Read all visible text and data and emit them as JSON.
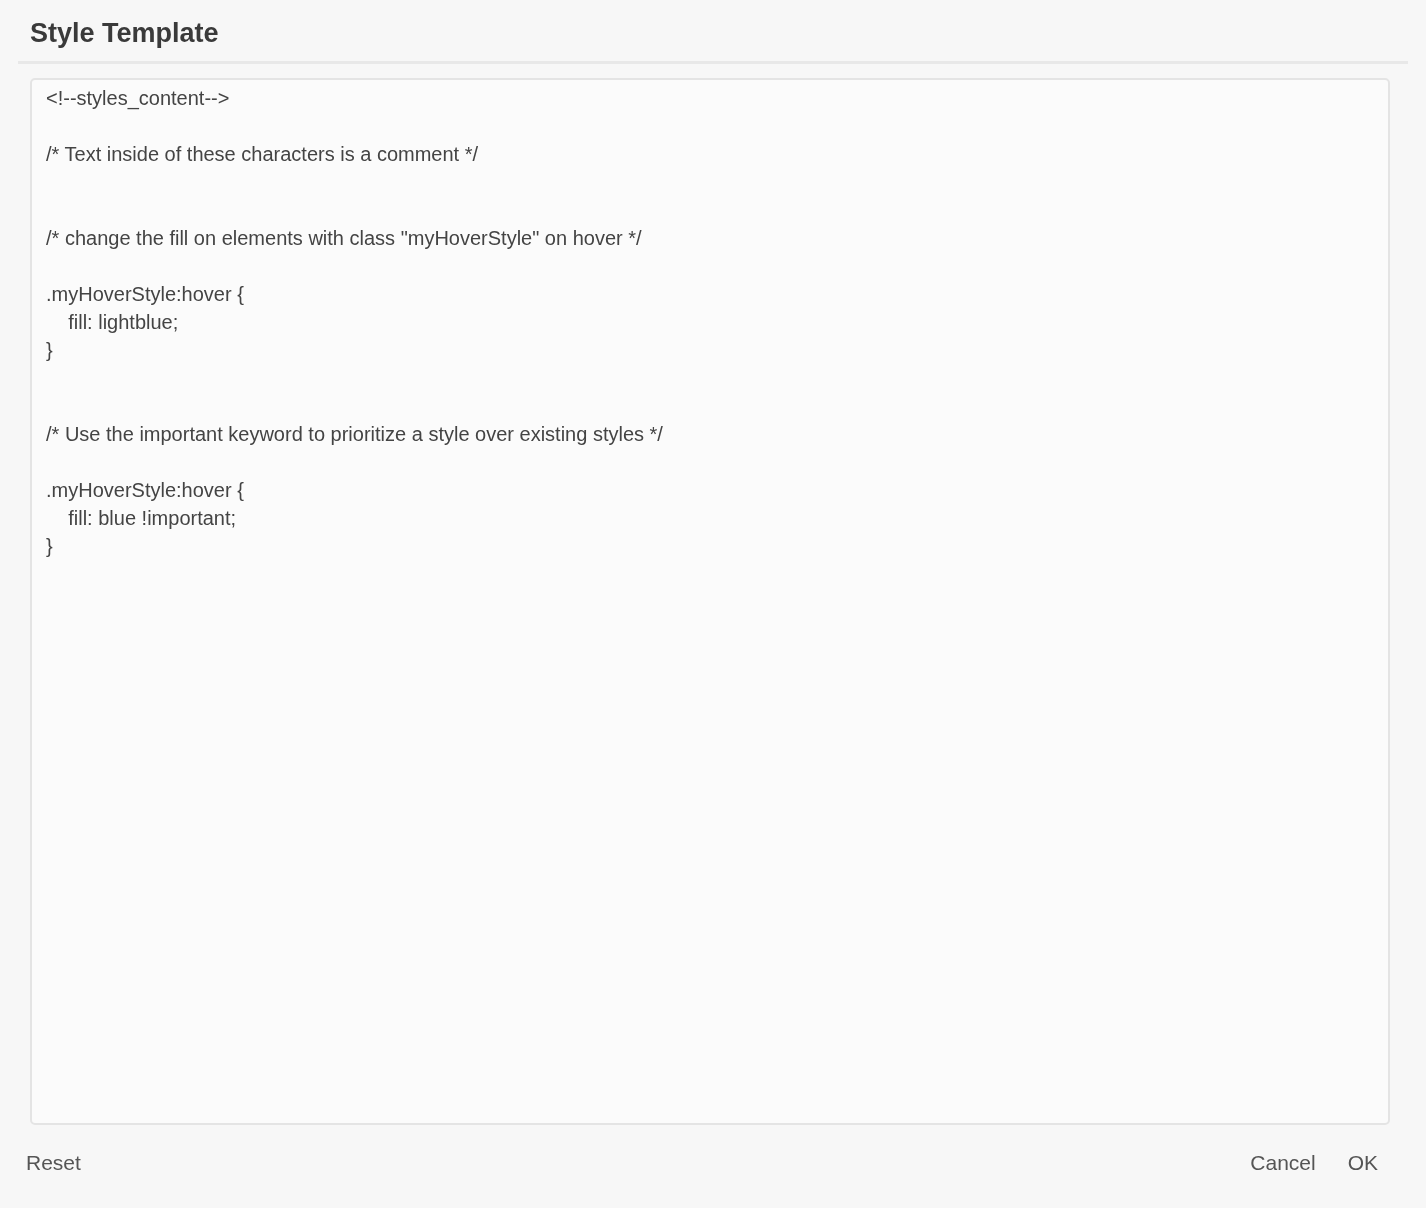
{
  "dialog": {
    "title": "Style Template"
  },
  "editor": {
    "value": "<!--styles_content-->\n\n/* Text inside of these characters is a comment */\n\n\n/* change the fill on elements with class \"myHoverStyle\" on hover */\n\n.myHoverStyle:hover {\n    fill: lightblue;\n}\n\n\n/* Use the important keyword to prioritize a style over existing styles */\n\n.myHoverStyle:hover {\n    fill: blue !important;\n}"
  },
  "buttons": {
    "left": [
      "Reset"
    ],
    "right": [
      "Cancel",
      "OK"
    ]
  }
}
